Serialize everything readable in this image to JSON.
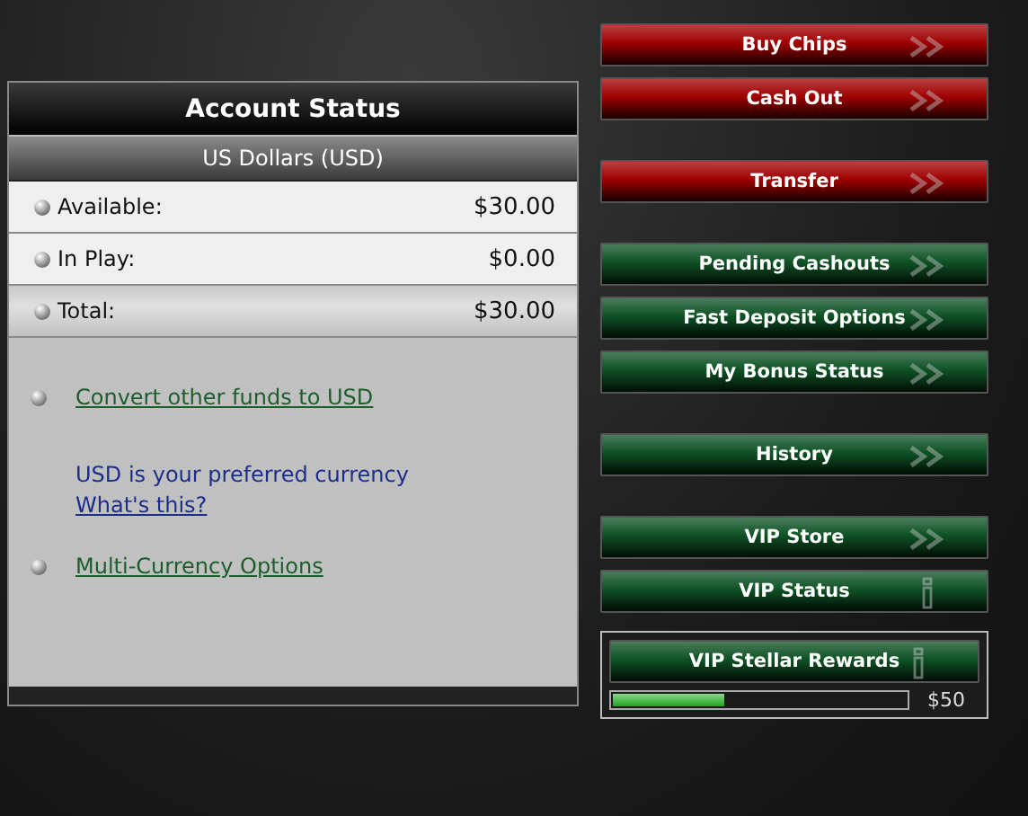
{
  "account": {
    "title": "Account Status",
    "currency": "US Dollars (USD)",
    "rows": [
      {
        "label": "Available:",
        "value": "$30.00",
        "kind": "plain"
      },
      {
        "label": "In Play:",
        "value": "$0.00",
        "kind": "plain"
      },
      {
        "label": "Total:",
        "value": "$30.00",
        "kind": "total"
      }
    ],
    "links": [
      {
        "kind": "link",
        "text": "Convert other funds to USD"
      },
      {
        "kind": "note",
        "text": "USD is your preferred currency",
        "link": "What's this?"
      },
      {
        "kind": "link",
        "text": "Multi-Currency Options"
      }
    ]
  },
  "button_groups": [
    [
      {
        "label": "Buy Chips",
        "color": "#a00000",
        "kind": "arrow"
      },
      {
        "label": "Cash Out",
        "color": "#a00000",
        "kind": "arrow"
      }
    ],
    [
      {
        "label": "Transfer",
        "color": "#a00000",
        "kind": "arrow"
      }
    ],
    [
      {
        "label": "Pending Cashouts",
        "color": "#0e5224",
        "kind": "arrow"
      },
      {
        "label": "Fast Deposit Options",
        "color": "#0e5224",
        "kind": "arrow"
      },
      {
        "label": "My Bonus Status",
        "color": "#0e5224",
        "kind": "arrow"
      }
    ],
    [
      {
        "label": "History",
        "color": "#0e5224",
        "kind": "arrow"
      }
    ],
    [
      {
        "label": "VIP Store",
        "color": "#0e5224",
        "kind": "arrow"
      },
      {
        "label": "VIP Status",
        "color": "#0e5224",
        "kind": "info"
      }
    ]
  ],
  "rewards": {
    "label": "VIP Stellar Rewards",
    "color": "#0e5224",
    "kind": "info",
    "level": 0.38,
    "amount": "$50"
  }
}
